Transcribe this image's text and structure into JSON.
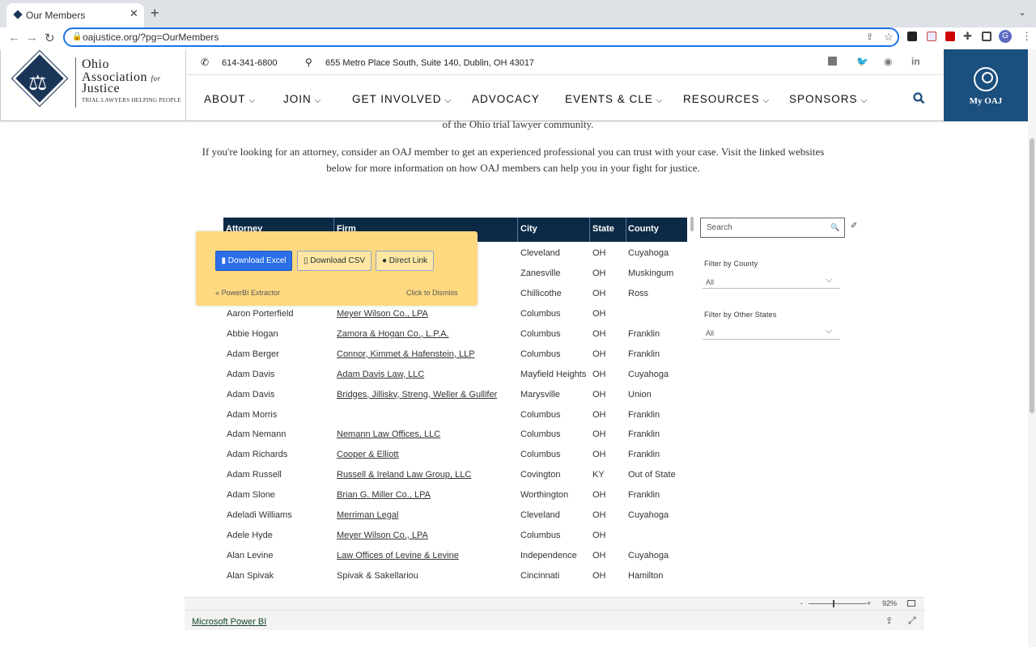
{
  "browser": {
    "tab_title": "Our Members",
    "url": "oajustice.org/?pg=OurMembers",
    "new_tab": "+",
    "profile_initial": "G"
  },
  "site": {
    "logo": {
      "line1": "Ohio",
      "line2": "Association",
      "line2_for": "for",
      "line3": "Justice",
      "tagline": "Trial Lawyers Helping People"
    },
    "phone": "614-341-6800",
    "address": "655 Metro Place South, Suite 140, Dublin, OH 43017",
    "nav": [
      "ABOUT",
      "JOIN",
      "GET INVOLVED",
      "ADVOCACY",
      "EVENTS & CLE",
      "RESOURCES",
      "SPONSORS"
    ],
    "my_oaj": "My OAJ"
  },
  "content": {
    "partial_line": "of the Ohio trial lawyer community.",
    "para_line1": "If you're looking for an attorney, consider an OAJ member to get an experienced professional you can trust with your case. Visit the linked websites",
    "para_line2": "below for more information on how OAJ members can help you in your fight for justice."
  },
  "table": {
    "headers": [
      "Attorney",
      "Firm",
      "City",
      "State",
      "County"
    ],
    "hidden_rows": [
      {
        "city": "Cleveland",
        "state": "OH",
        "county": "Cuyahoga"
      },
      {
        "city": "Zanesville",
        "state": "OH",
        "county": "Muskingum"
      },
      {
        "city": "Chillicothe",
        "state": "OH",
        "county": "Ross"
      }
    ],
    "rows": [
      {
        "attorney": "Aaron Porterfield",
        "firm": "Meyer Wilson Co., LPA",
        "firm_link": true,
        "city": "Columbus",
        "state": "OH",
        "county": ""
      },
      {
        "attorney": "Abbie Hogan",
        "firm": "Zamora & Hogan Co., L.P.A.",
        "firm_link": true,
        "city": "Columbus",
        "state": "OH",
        "county": "Franklin"
      },
      {
        "attorney": "Adam Berger",
        "firm": "Connor, Kimmet & Hafenstein, LLP",
        "firm_link": true,
        "city": "Columbus",
        "state": "OH",
        "county": "Franklin"
      },
      {
        "attorney": "Adam Davis",
        "firm": "Adam Davis Law, LLC",
        "firm_link": true,
        "city": "Mayfield Heights",
        "state": "OH",
        "county": "Cuyahoga"
      },
      {
        "attorney": "Adam Davis",
        "firm": "Bridges, Jillisky, Streng, Weller & Gullifer",
        "firm_link": true,
        "city": "Marysville",
        "state": "OH",
        "county": "Union"
      },
      {
        "attorney": "Adam Morris",
        "firm": "",
        "firm_link": false,
        "city": "Columbus",
        "state": "OH",
        "county": "Franklin"
      },
      {
        "attorney": "Adam Nemann",
        "firm": "Nemann Law Offices, LLC",
        "firm_link": true,
        "city": "Columbus",
        "state": "OH",
        "county": "Franklin"
      },
      {
        "attorney": "Adam Richards",
        "firm": "Cooper & Elliott",
        "firm_link": true,
        "city": "Columbus",
        "state": "OH",
        "county": "Franklin"
      },
      {
        "attorney": "Adam Russell",
        "firm": "Russell & Ireland Law Group, LLC",
        "firm_link": true,
        "city": "Covington",
        "state": "KY",
        "county": "Out of State"
      },
      {
        "attorney": "Adam Slone",
        "firm": "Brian G. Miller Co., LPA",
        "firm_link": true,
        "city": "Worthington",
        "state": "OH",
        "county": "Franklin"
      },
      {
        "attorney": "Adeladi Williams",
        "firm": "Merriman Legal",
        "firm_link": true,
        "city": "Cleveland",
        "state": "OH",
        "county": "Cuyahoga"
      },
      {
        "attorney": "Adele Hyde",
        "firm": "Meyer Wilson Co., LPA",
        "firm_link": true,
        "city": "Columbus",
        "state": "OH",
        "county": ""
      },
      {
        "attorney": "Alan Levine",
        "firm": "Law Offices of Levine & Levine",
        "firm_link": true,
        "city": "Independence",
        "state": "OH",
        "county": "Cuyahoga"
      },
      {
        "attorney": "Alan Spivak",
        "firm": "Spivak & Sakellariou",
        "firm_link": false,
        "city": "Cincinnati",
        "state": "OH",
        "county": "Hamilton"
      }
    ]
  },
  "filters": {
    "search_placeholder": "Search",
    "county_label": "Filter by County",
    "county_value": "All",
    "states_label": "Filter by Other States",
    "states_value": "All"
  },
  "popup": {
    "download_excel": "Download Excel",
    "download_csv": "Download CSV",
    "direct_link": "Direct Link",
    "extractor": "« PowerBI Extractor",
    "dismiss": "Click to Dismiss"
  },
  "powerbi": {
    "zoom": "92%",
    "minus": "-",
    "plus": "+",
    "link": "Microsoft Power BI"
  }
}
